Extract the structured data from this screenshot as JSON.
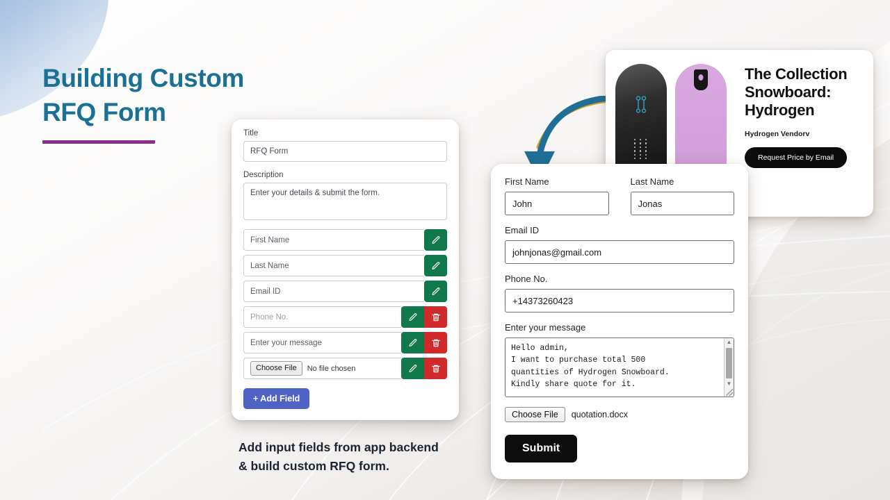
{
  "headline": {
    "line1": "Building Custom",
    "line2": "RFQ Form"
  },
  "caption": {
    "line1": "Add input fields from app backend",
    "line2": "& build custom RFQ form."
  },
  "colors": {
    "headline": "#1b7193",
    "rule": "#8b2d8b",
    "edit_button": "#10794b",
    "delete_button": "#d12a2a",
    "add_field_button": "#4f63c4",
    "submit_button": "#0d0d0d",
    "arrow_primary": "#1f6f96",
    "arrow_accent": "#d99b2b"
  },
  "builder": {
    "title_label": "Title",
    "title_value": "RFQ Form",
    "description_label": "Description",
    "description_value": "Enter your details & submit the form.",
    "fields": [
      {
        "label": "First Name",
        "type": "text",
        "is_placeholder": false,
        "edit_icon": "pencil-icon",
        "deletable": false
      },
      {
        "label": "Last Name",
        "type": "text",
        "is_placeholder": false,
        "edit_icon": "pencil-icon",
        "deletable": false
      },
      {
        "label": "Email ID",
        "type": "text",
        "is_placeholder": false,
        "edit_icon": "pencil-icon",
        "deletable": false
      },
      {
        "label": "Phone No.",
        "type": "text",
        "is_placeholder": true,
        "edit_icon": "pencil-icon",
        "deletable": true,
        "delete_icon": "trash-icon"
      },
      {
        "label": "Enter your message",
        "type": "text",
        "is_placeholder": false,
        "edit_icon": "pencil-icon",
        "deletable": true,
        "delete_icon": "trash-icon"
      },
      {
        "label": "",
        "type": "file",
        "choose_file_label": "Choose File",
        "file_status": "No file chosen",
        "edit_icon": "pencil-icon",
        "deletable": true,
        "delete_icon": "trash-icon"
      }
    ],
    "add_field_label": "+ Add Field"
  },
  "storefront_form": {
    "first_name_label": "First Name",
    "first_name_value": "John",
    "last_name_label": "Last Name",
    "last_name_value": "Jonas",
    "email_label": "Email ID",
    "email_value": "johnjonas@gmail.com",
    "phone_label": "Phone No.",
    "phone_value": "+14373260423",
    "message_label": "Enter your message",
    "message_value": "Hello admin,\nI want to purchase total 500\nquantities of Hydrogen Snowboard.\nKindly share quote for it.",
    "choose_file_label": "Choose File",
    "file_name": "quotation.docx",
    "submit_label": "Submit",
    "scrollbar": {
      "up_glyph": "▲",
      "down_glyph": "▼"
    }
  },
  "product_card": {
    "title": "The Collection Snowboard: Hydrogen",
    "vendor": "Hydrogen Vendorv",
    "request_price_label": "Request Price by Email"
  }
}
